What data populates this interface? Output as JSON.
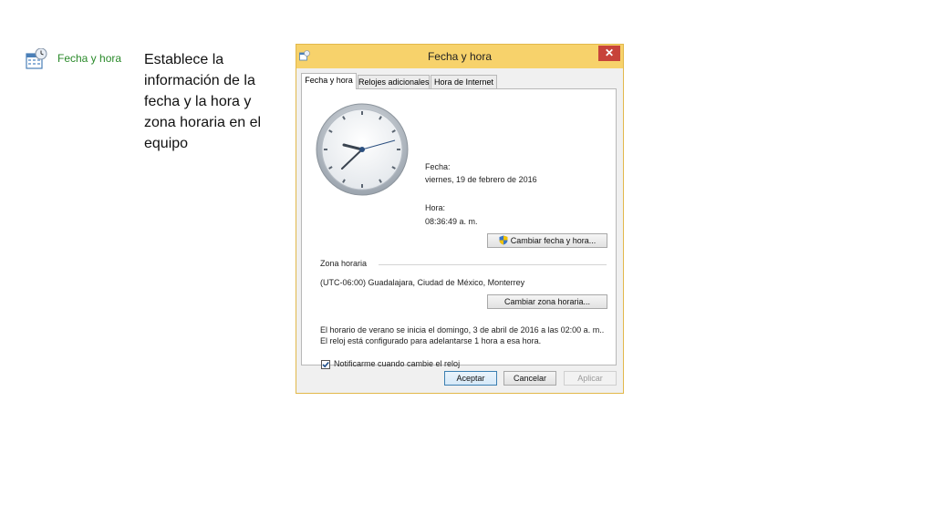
{
  "slide": {
    "item_label": "Fecha y hora",
    "description": "Establece la información de la fecha y la hora  y zona horaria en el equipo"
  },
  "dialog": {
    "title": "Fecha y hora",
    "close_label": "✕",
    "tabs": [
      {
        "label": "Fecha y hora",
        "active": true
      },
      {
        "label": "Relojes adicionales",
        "active": false
      },
      {
        "label": "Hora de Internet",
        "active": false
      }
    ],
    "date_label": "Fecha:",
    "date_value": "viernes, 19 de febrero de 2016",
    "time_label": "Hora:",
    "time_value": "08:36:49 a. m.",
    "change_datetime_button": "Cambiar fecha y hora...",
    "timezone_group": "Zona horaria",
    "timezone_value": "(UTC-06:00) Guadalajara, Ciudad de México, Monterrey",
    "change_timezone_button": "Cambiar zona horaria...",
    "dst_note": "El horario de verano se inicia el domingo, 3 de abril de 2016 a las 02:00 a. m.. El reloj está configurado para adelantarse 1 hora a esa hora.",
    "notify_checkbox_label": "Notificarme cuando cambie el reloj",
    "notify_checked": true,
    "buttons": {
      "ok": "Aceptar",
      "cancel": "Cancelar",
      "apply": "Aplicar"
    }
  },
  "colors": {
    "titlebar": "#f7d26b",
    "close": "#c7433a",
    "item_label": "#2a8a2a"
  },
  "icons": {
    "control_panel_item": "calendar-clock-icon",
    "shield": "uac-shield-icon"
  }
}
